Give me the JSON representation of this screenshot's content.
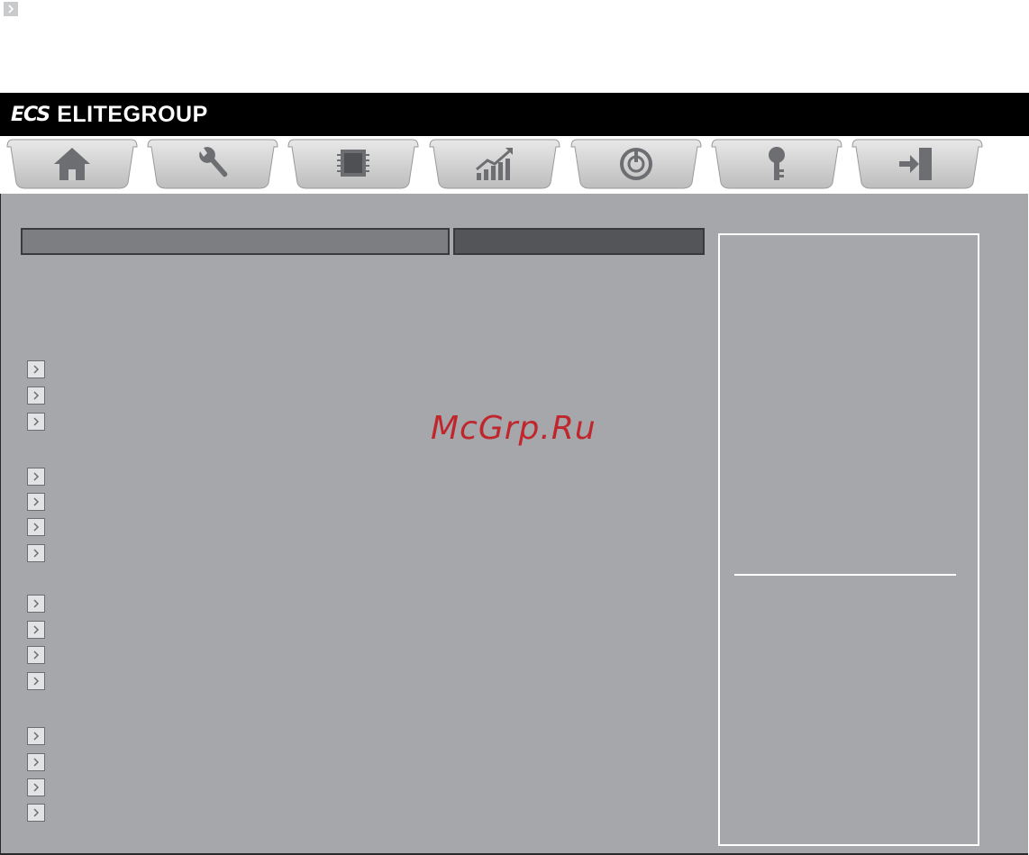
{
  "header": {
    "logo_mark": "ECS",
    "brand": "ELITEGROUP"
  },
  "tabs": [
    {
      "icon": "home-icon"
    },
    {
      "icon": "wrench-icon"
    },
    {
      "icon": "chip-icon"
    },
    {
      "icon": "chart-up-icon"
    },
    {
      "icon": "power-icon"
    },
    {
      "icon": "key-icon"
    },
    {
      "icon": "exit-icon"
    }
  ],
  "menu_groups": [
    {
      "items": 3
    },
    {
      "items": 4
    },
    {
      "items": 4
    },
    {
      "items": 4
    }
  ],
  "watermark": "McGrp.Ru",
  "colors": {
    "panel_bg": "#a6a7ab",
    "header_bg": "#000000",
    "watermark": "#c0272d"
  }
}
